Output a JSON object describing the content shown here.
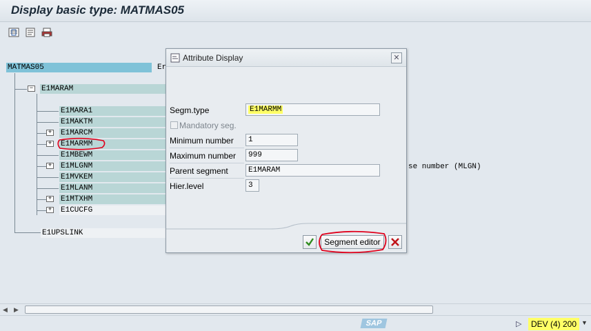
{
  "window": {
    "title": "Display basic type: MATMAS05"
  },
  "toolbar": {
    "icons": [
      "expand-tree-icon",
      "segment-editor-icon",
      "print-icon"
    ]
  },
  "tree": {
    "root": "MATMAS05",
    "root_suffix": "Er",
    "level1_parent": "E1MARAM",
    "children": [
      "E1MARA1",
      "E1MAKTM",
      "E1MARCM",
      "E1MARMM",
      "E1MBEWM",
      "E1MLGNM",
      "E1MVKEM",
      "E1MLANM",
      "E1MTXHM",
      "E1CUCFG"
    ],
    "last_child": "E1UPSLINK",
    "right_text": "se number (MLGN)"
  },
  "dialog": {
    "title": "Attribute Display",
    "fields": {
      "segm_type_label": "Segm.type",
      "segm_type_value": "E1MARMM",
      "mandatory_label": "Mandatory seg.",
      "min_label": "Minimum number",
      "min_value": "1",
      "max_label": "Maximum number",
      "max_value": "999",
      "parent_label": "Parent segment",
      "parent_value": "E1MARAM",
      "hier_label": "Hier.level",
      "hier_value": "3"
    },
    "buttons": {
      "segment_editor": "Segment editor"
    }
  },
  "status": {
    "sap_logo": "SAP",
    "system": "DEV (4) 200"
  },
  "colors": {
    "highlight": "#ffff66",
    "annotation": "#e0001b",
    "tree_highlight": "#b9d6d6"
  }
}
